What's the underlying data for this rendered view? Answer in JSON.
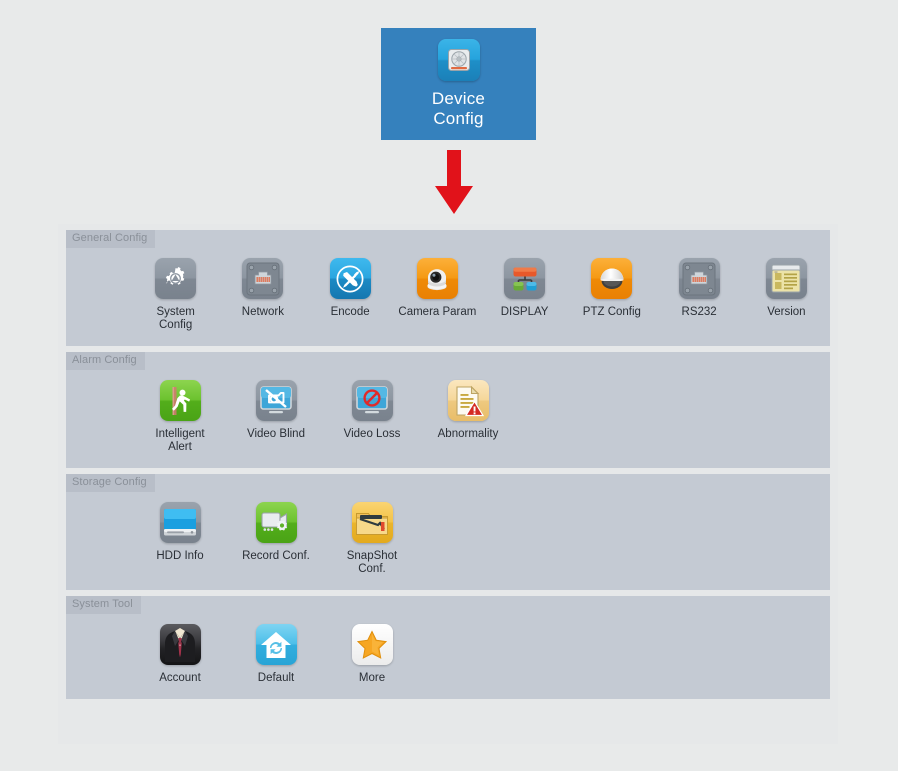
{
  "launcher": {
    "label_line1": "Device",
    "label_line2": "Config",
    "icon": "hdd-device-icon",
    "bg_color": "#3581bd"
  },
  "arrow": {
    "name": "down-arrow",
    "color": "#e1121a"
  },
  "panel": {
    "bg_color": "#e6e8e9",
    "group_bg_color": "#c4cad3",
    "label_bg_color": "#b8bec8",
    "label_text_color": "#8a9099",
    "groups": [
      {
        "label": "General Config",
        "items": [
          {
            "label": "System\nConfig",
            "icon": "gear-icon",
            "tile": "ic-grey"
          },
          {
            "label": "Network",
            "icon": "ethernet-port-icon",
            "tile": "ic-grey"
          },
          {
            "label": "Encode",
            "icon": "tools-icon",
            "tile": "ic-blue"
          },
          {
            "label": "Camera Param",
            "icon": "dome-camera-icon",
            "tile": "ic-orange"
          },
          {
            "label": "DISPLAY",
            "icon": "layout-nodes-icon",
            "tile": "ic-grey"
          },
          {
            "label": "PTZ Config",
            "icon": "ptz-dome-icon",
            "tile": "ic-orange"
          },
          {
            "label": "RS232",
            "icon": "ethernet-port-icon",
            "tile": "ic-grey"
          },
          {
            "label": "Version",
            "icon": "document-info-icon",
            "tile": "ic-grey"
          }
        ]
      },
      {
        "label": "Alarm Config",
        "items": [
          {
            "label": "Intelligent\nAlert",
            "icon": "walking-person-icon",
            "tile": "ic-green"
          },
          {
            "label": "Video Blind",
            "icon": "camera-blocked-icon",
            "tile": "ic-grey"
          },
          {
            "label": "Video Loss",
            "icon": "no-signal-icon",
            "tile": "ic-grey"
          },
          {
            "label": "Abnormality",
            "icon": "document-warning-icon",
            "tile": "ic-tan"
          }
        ]
      },
      {
        "label": "Storage Config",
        "items": [
          {
            "label": "HDD Info",
            "icon": "hard-drive-icon",
            "tile": "ic-grey"
          },
          {
            "label": "Record Conf.",
            "icon": "record-gear-icon",
            "tile": "ic-green"
          },
          {
            "label": "SnapShot\nConf.",
            "icon": "snapshot-icon",
            "tile": "ic-gold"
          }
        ]
      },
      {
        "label": "System Tool",
        "items": [
          {
            "label": "Account",
            "icon": "suit-person-icon",
            "tile": "ic-dark"
          },
          {
            "label": "Default",
            "icon": "home-refresh-icon",
            "tile": "ic-skyblue"
          },
          {
            "label": "More",
            "icon": "star-icon",
            "tile": "ic-white"
          }
        ]
      }
    ]
  }
}
